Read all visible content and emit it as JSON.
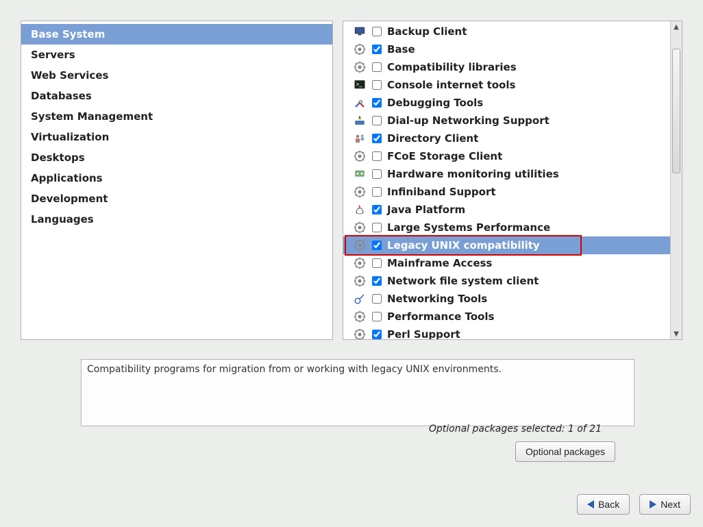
{
  "categories": {
    "items": [
      {
        "label": "Base System",
        "selected": true
      },
      {
        "label": "Servers"
      },
      {
        "label": "Web Services"
      },
      {
        "label": "Databases"
      },
      {
        "label": "System Management"
      },
      {
        "label": "Virtualization"
      },
      {
        "label": "Desktops"
      },
      {
        "label": "Applications"
      },
      {
        "label": "Development"
      },
      {
        "label": "Languages"
      }
    ]
  },
  "packages": {
    "items": [
      {
        "label": "Backup Client",
        "checked": false,
        "icon": "display"
      },
      {
        "label": "Base",
        "checked": true,
        "icon": "gear"
      },
      {
        "label": "Compatibility libraries",
        "checked": false,
        "icon": "gear"
      },
      {
        "label": "Console internet tools",
        "checked": false,
        "icon": "terminal"
      },
      {
        "label": "Debugging Tools",
        "checked": true,
        "icon": "tools"
      },
      {
        "label": "Dial-up Networking Support",
        "checked": false,
        "icon": "modem"
      },
      {
        "label": "Directory Client",
        "checked": true,
        "icon": "directory"
      },
      {
        "label": "FCoE Storage Client",
        "checked": false,
        "icon": "gear"
      },
      {
        "label": "Hardware monitoring utilities",
        "checked": false,
        "icon": "hw"
      },
      {
        "label": "Infiniband Support",
        "checked": false,
        "icon": "gear"
      },
      {
        "label": "Java Platform",
        "checked": true,
        "icon": "java"
      },
      {
        "label": "Large Systems Performance",
        "checked": false,
        "icon": "gear"
      },
      {
        "label": "Legacy UNIX compatibility",
        "checked": true,
        "icon": "gear",
        "selected": true,
        "highlight": true
      },
      {
        "label": "Mainframe Access",
        "checked": false,
        "icon": "gear"
      },
      {
        "label": "Network file system client",
        "checked": true,
        "icon": "gear"
      },
      {
        "label": "Networking Tools",
        "checked": false,
        "icon": "nettool"
      },
      {
        "label": "Performance Tools",
        "checked": false,
        "icon": "gear"
      },
      {
        "label": "Perl Support",
        "checked": true,
        "icon": "gear"
      }
    ]
  },
  "description": "Compatibility programs for migration from or working with legacy UNIX environments.",
  "status_text": "Optional packages selected: 1 of 21",
  "buttons": {
    "optional": "Optional packages",
    "back": "Back",
    "next": "Next"
  }
}
